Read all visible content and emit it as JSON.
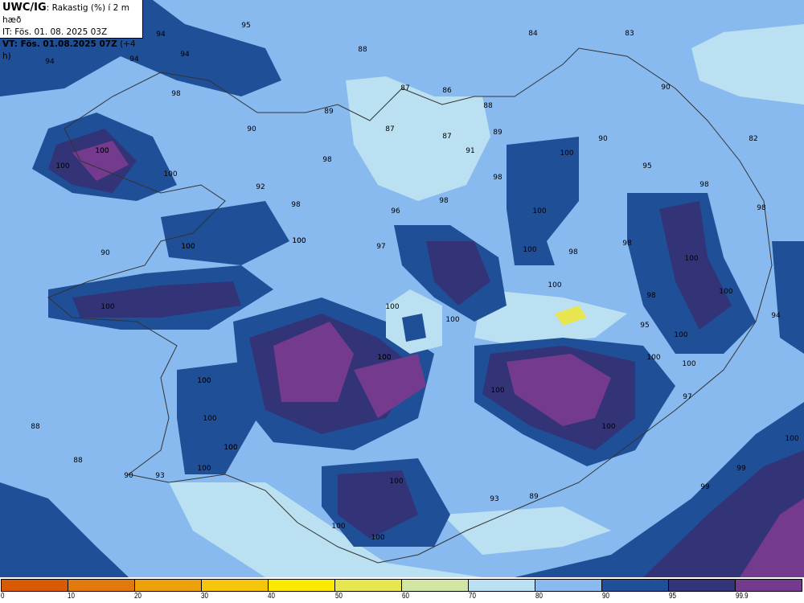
{
  "header": {
    "model": "UWC/IG",
    "variable": ": Rakastig (%) í 2 m hæð",
    "init_time": "IT: Fös. 01. 08. 2025 03Z",
    "valid_time": "VT: Fös. 01.08.2025 07Z",
    "lead": " (+4 h)"
  },
  "legend": {
    "colors": [
      "#d95a04",
      "#e2790c",
      "#eca10a",
      "#f6c60d",
      "#fbea00",
      "#e8e650",
      "#d2e6a4",
      "#bae0f2",
      "#88baf0",
      "#1f4f97",
      "#333378",
      "#743a8d"
    ],
    "ticks": [
      "0",
      "10",
      "20",
      "30",
      "40",
      "50",
      "60",
      "70",
      "80",
      "90",
      "95",
      "99.9"
    ]
  },
  "map_labels": [
    "95",
    "94",
    "94",
    "94",
    "94",
    "88",
    "84",
    "83",
    "90",
    "87",
    "86",
    "88",
    "98",
    "89",
    "90",
    "87",
    "87",
    "89",
    "90",
    "82",
    "100",
    "100",
    "98",
    "91",
    "100",
    "100",
    "98",
    "95",
    "92",
    "98",
    "98",
    "96",
    "98",
    "100",
    "98",
    "100",
    "97",
    "100",
    "98",
    "100",
    "98",
    "100",
    "90",
    "100",
    "100",
    "98",
    "100",
    "100",
    "100",
    "95",
    "94",
    "100",
    "100",
    "100",
    "100",
    "100",
    "100",
    "97",
    "100",
    "100",
    "88",
    "100",
    "88",
    "100",
    "90",
    "93",
    "100",
    "99",
    "100",
    "99",
    "93",
    "89",
    "100",
    "100",
    "100",
    "100",
    "100",
    "100",
    "100",
    "100"
  ]
}
